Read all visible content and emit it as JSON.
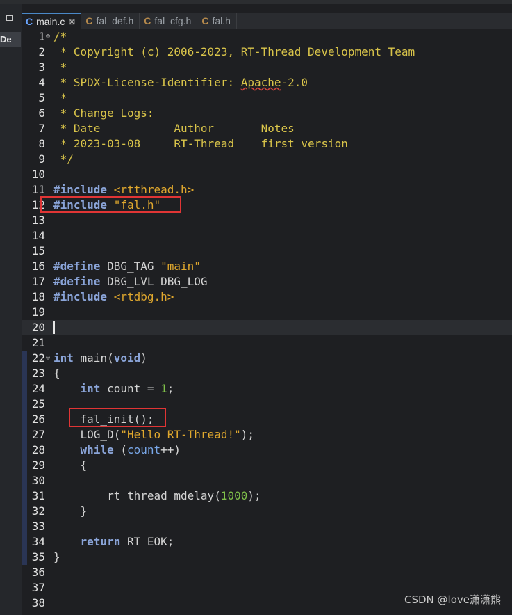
{
  "sidebar": {
    "label": "De"
  },
  "tabs": [
    {
      "label": "main.c",
      "active": true,
      "closable": true
    },
    {
      "label": "fal_def.h"
    },
    {
      "label": "fal_cfg.h"
    },
    {
      "label": "fal.h"
    }
  ],
  "tab_icon": "C",
  "close_glyph": "⊠",
  "lines": [
    {
      "n": "1",
      "fold": true,
      "html": "<span class=\"cmt\">/*</span>"
    },
    {
      "n": "2",
      "html": "<span class=\"cmt\"> * Copyright (c) 2006-2023, RT-Thread Development Team</span>"
    },
    {
      "n": "3",
      "html": "<span class=\"cmt\"> *</span>"
    },
    {
      "n": "4",
      "html": "<span class=\"cmt\"> * SPDX-License-Identifier: <span class=\"wavy\">Apache</span>-2.0</span>"
    },
    {
      "n": "5",
      "html": "<span class=\"cmt\"> *</span>"
    },
    {
      "n": "6",
      "html": "<span class=\"cmt\"> * Change Logs:</span>"
    },
    {
      "n": "7",
      "html": "<span class=\"cmt\"> * Date           Author       Notes</span>"
    },
    {
      "n": "8",
      "html": "<span class=\"cmt\"> * 2023-03-08     RT-Thread    first version</span>"
    },
    {
      "n": "9",
      "html": "<span class=\"cmt\"> */</span>"
    },
    {
      "n": "10",
      "html": ""
    },
    {
      "n": "11",
      "html": "<span class=\"kw\">#include</span> <span class=\"str\">&lt;rtthread.h&gt;</span>"
    },
    {
      "n": "12",
      "html": "<span class=\"kw\">#include</span> <span class=\"str\">\"fal.h\"</span>"
    },
    {
      "n": "13",
      "html": ""
    },
    {
      "n": "14",
      "html": ""
    },
    {
      "n": "15",
      "html": ""
    },
    {
      "n": "16",
      "html": "<span class=\"kw\">#define</span> DBG_TAG <span class=\"str\">\"main\"</span>"
    },
    {
      "n": "17",
      "html": "<span class=\"kw\">#define</span> DBG_LVL DBG_LOG"
    },
    {
      "n": "18",
      "html": "<span class=\"kw\">#include</span> <span class=\"str\">&lt;rtdbg.h&gt;</span>"
    },
    {
      "n": "19",
      "html": ""
    },
    {
      "n": "20",
      "html": "",
      "current": true
    },
    {
      "n": "21",
      "html": ""
    },
    {
      "n": "22",
      "fold": true,
      "html": "<span class=\"kw\">int</span> main(<span class=\"kw\">void</span>)"
    },
    {
      "n": "23",
      "html": "{"
    },
    {
      "n": "24",
      "html": "    <span class=\"kw\">int</span> count = <span class=\"num\">1</span>;"
    },
    {
      "n": "25",
      "html": ""
    },
    {
      "n": "26",
      "html": "    fal_init();"
    },
    {
      "n": "27",
      "html": "    LOG_D(<span class=\"str\">\"Hello RT-Thread!\"</span>);"
    },
    {
      "n": "28",
      "html": "    <span class=\"kw\">while</span> (<span class=\"var\">count</span>++)"
    },
    {
      "n": "29",
      "html": "    {"
    },
    {
      "n": "30",
      "html": ""
    },
    {
      "n": "31",
      "html": "        rt_thread_mdelay(<span class=\"num\">1000</span>);"
    },
    {
      "n": "32",
      "html": "    }"
    },
    {
      "n": "33",
      "html": ""
    },
    {
      "n": "34",
      "html": "    <span class=\"kw\">return</span> RT_EOK;"
    },
    {
      "n": "35",
      "html": "}"
    },
    {
      "n": "36",
      "html": ""
    },
    {
      "n": "37",
      "html": ""
    },
    {
      "n": "38",
      "html": ""
    }
  ],
  "watermark": "CSDN @love潇潇熊",
  "colors": {
    "comment": "#d9c44a",
    "keyword": "#8aa4d8",
    "string": "#e0a82e",
    "number": "#7fc04a",
    "highlight_box": "#e03535"
  }
}
